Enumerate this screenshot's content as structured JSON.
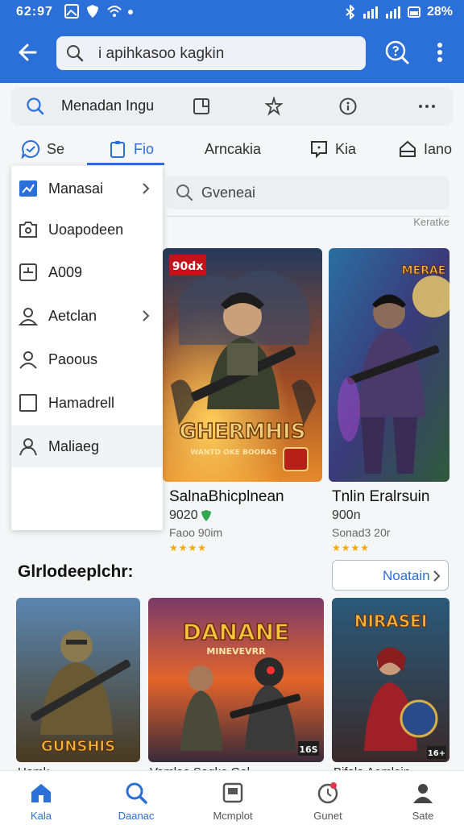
{
  "status": {
    "time": "62:97",
    "battery": "28%"
  },
  "appbar": {
    "search_text": "i apihkasoo kagkin"
  },
  "toolbar": {
    "label": "Menadan Ingu"
  },
  "tabs": [
    {
      "label": "Se"
    },
    {
      "label": "Fio"
    },
    {
      "label": "Arncakia"
    },
    {
      "label": "Kia"
    },
    {
      "label": "Iano"
    }
  ],
  "content_search": {
    "placeholder": "Gveneai"
  },
  "review_label": "Keratke",
  "menu": {
    "items": [
      {
        "label": "Manasai"
      },
      {
        "label": "Uoapodeen"
      },
      {
        "label": "A009"
      },
      {
        "label": "Aetclan"
      },
      {
        "label": "Paoous"
      },
      {
        "label": "Hamadrell"
      },
      {
        "label": "Maliaeg"
      }
    ]
  },
  "featured": [
    {
      "title": "SalnaBhicplnean",
      "price": "9020",
      "subtitle": "Faoo 90im",
      "badge": "90dx",
      "logo": "GHERMHIS",
      "tagline": "WANTD OKE BOORAS",
      "stars": "★★★★"
    },
    {
      "title": "Tnlin Eralrsuin",
      "price": "900n",
      "subtitle": "Sonad3 20r",
      "badge": "MERAE",
      "stars": "★★★★"
    }
  ],
  "section": {
    "title": "Glrlodeeplchr:",
    "button_label": "Noatain"
  },
  "games": [
    {
      "logo": "GUNSHIS",
      "peek": "Hamk..."
    },
    {
      "logo": "DANANE",
      "sublogo": "MINEVEVRR",
      "age": "16S",
      "peek": "Vamlaa Sagko Gal"
    },
    {
      "logo": "NIRASEI",
      "age": "16+",
      "peek": "Bifala Aemlein"
    }
  ],
  "bottom_nav": [
    {
      "label": "Kala"
    },
    {
      "label": "Daanac"
    },
    {
      "label": "Mcmplot"
    },
    {
      "label": "Gunet"
    },
    {
      "label": "Sate"
    }
  ],
  "colors": {
    "accent": "#2b6fd8",
    "star": "#f5a800",
    "background": "#f5f6f8"
  }
}
